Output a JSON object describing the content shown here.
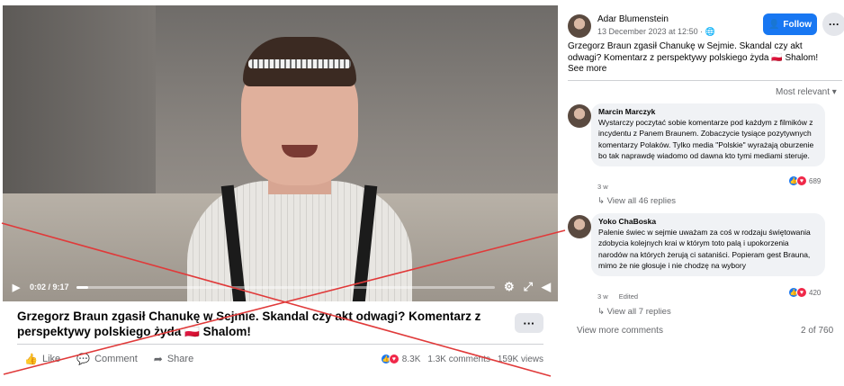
{
  "video": {
    "time": "0:02 / 9:17",
    "progress_fraction": 0.004,
    "title": "Grzegorz Braun zgasił Chanukę w Sejmie. Skandal czy akt odwagi? Komentarz z perspektywy polskiego żyda 🇵🇱 Shalom!",
    "more_label": "···"
  },
  "actions": {
    "like": "Like",
    "comment": "Comment",
    "share": "Share"
  },
  "stats": {
    "reactions": "8.3K",
    "comments": "1.3K comments",
    "views": "159K views"
  },
  "post": {
    "author": "Adar Blumenstein",
    "date": "13 December 2023 at 12:50 · ",
    "follow_label": "Follow",
    "more_label": "···",
    "text": "Grzegorz Braun zgasił Chanukę w Sejmie. Skandal czy akt odwagi? Komentarz z perspektywy polskiego żyda 🇵🇱 Shalom!",
    "see_more": "See more",
    "sort_label": "Most relevant ▾"
  },
  "comments": [
    {
      "author": "Marcin Marczyk",
      "text": "Wystarczy poczytać sobie komentarze pod każdym z filmików z incydentu z Panem Braunem. Zobaczycie tysiące pozytywnych komentarzy Polaków. Tylko media \"Polskie\" wyrażają oburzenie bo tak naprawdę wiadomo od dawna kto tymi mediami steruje.",
      "time": "3 w",
      "edited": "",
      "reactions": "689",
      "replies": "View all 46 replies"
    },
    {
      "author": "Yoko ChaBoska",
      "text": "Palenie świec w sejmie uważam za coś w rodzaju świętowania zdobycia kolejnych krai w którym toto palą i upokorzenia narodów na których żerują ci sataniści. Popieram gest Brauna, mimo że nie głosuje i nie chodzę na wybory",
      "time": "3 w",
      "edited": "Edited",
      "reactions": "420",
      "replies": "View all 7 replies"
    }
  ],
  "footer": {
    "view_more": "View more comments",
    "pager": "2 of 760"
  },
  "colors": {
    "accent": "#1877f2",
    "love": "#f02849",
    "cross": "#e03a3a"
  }
}
